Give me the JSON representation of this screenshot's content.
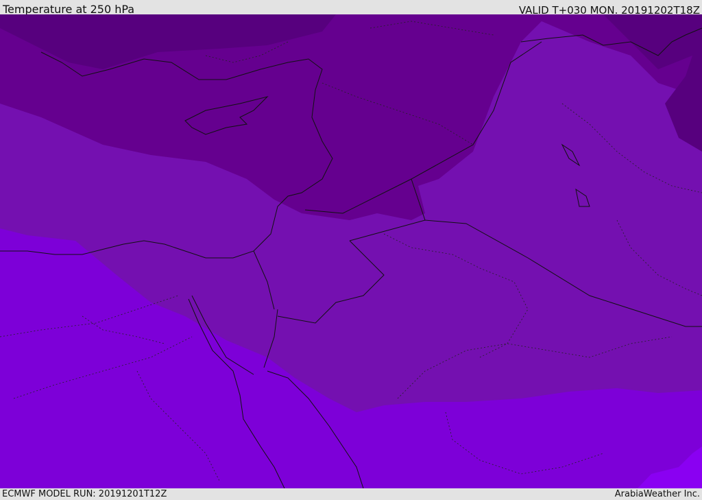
{
  "header": {
    "title": "Temperature at 250 hPa",
    "valid": "VALID T+030 MON. 20191202T18Z"
  },
  "footer": {
    "model_run": "ECMWF MODEL RUN: 20191201T12Z",
    "credit": "ArabiaWeather Inc."
  },
  "map": {
    "colors": {
      "band_coldest": "#57007e",
      "band_cold": "#65008f",
      "band_mid": "#7410b0",
      "band_warm": "#7d00d8",
      "band_warmest": "#8a00f2",
      "coastline": "#111111",
      "border": "#111111"
    }
  }
}
